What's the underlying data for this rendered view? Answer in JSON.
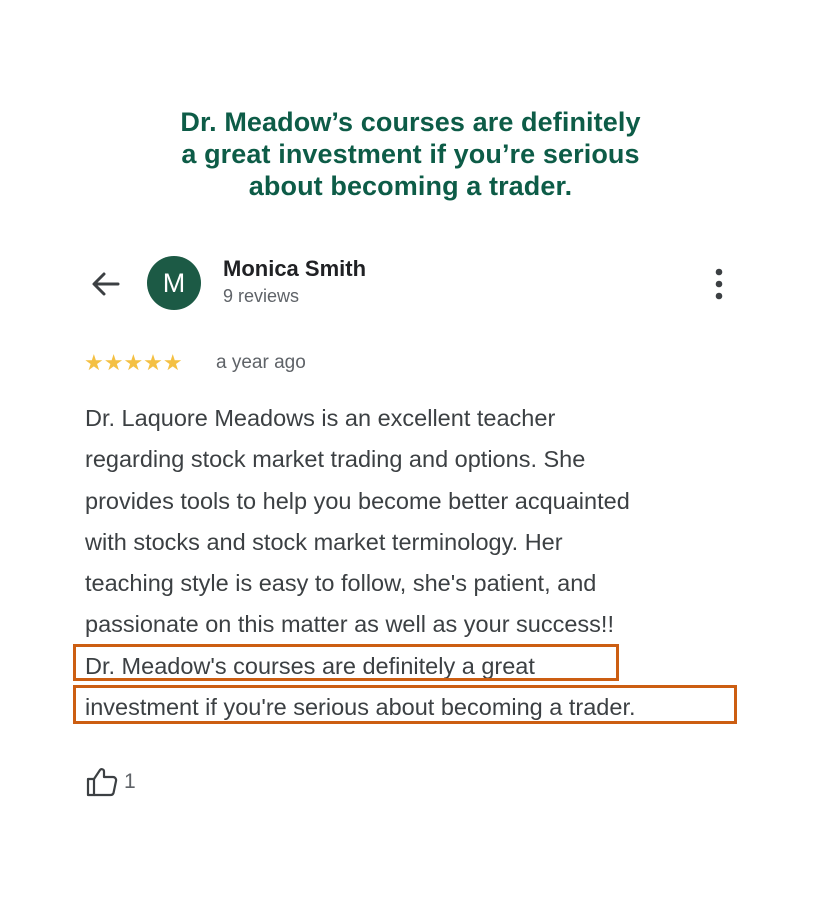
{
  "headline": {
    "lines": [
      "Dr. Meadow’s courses are definitely",
      "a great investment if you’re serious",
      "about becoming a trader."
    ],
    "color": "#0d5c47"
  },
  "header": {
    "back_icon": "arrow-left-icon",
    "more_icon": "more-vert-icon"
  },
  "reviewer": {
    "initial": "M",
    "name": "Monica Smith",
    "reviews_count": "9 reviews",
    "avatar_color": "#1c5a45"
  },
  "review": {
    "rating": 5,
    "stars": "★★★★★",
    "star_color": "#f4c043",
    "date": "a year ago",
    "lines": [
      "Dr. Laquore Meadows is an excellent teacher",
      "regarding stock market trading and options. She",
      "provides tools to help you become better acquainted",
      "with stocks and stock market terminology. Her",
      "teaching style is easy to follow, she's patient, and",
      "passionate on this matter as well as your success!!",
      "Dr. Meadow's courses are definitely a great",
      "investment if you're serious about becoming a trader."
    ],
    "highlight_color": "#cc5e12"
  },
  "actions": {
    "like_icon": "thumbs-up-icon",
    "like_count": "1"
  }
}
